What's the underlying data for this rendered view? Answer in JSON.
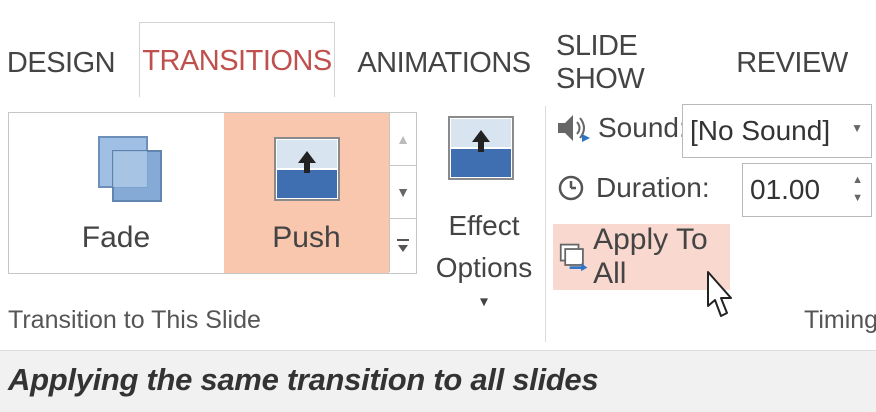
{
  "tabs": [
    {
      "label": "DESIGN",
      "active": false
    },
    {
      "label": "TRANSITIONS",
      "active": true
    },
    {
      "label": "ANIMATIONS",
      "active": false
    },
    {
      "label": "SLIDE SHOW",
      "active": false
    },
    {
      "label": "REVIEW",
      "active": false
    }
  ],
  "transition_gallery": {
    "items": [
      {
        "label": "Fade",
        "icon": "fade-icon",
        "selected": false
      },
      {
        "label": "Push",
        "icon": "push-icon",
        "selected": true
      }
    ],
    "group_label": "Transition to This Slide"
  },
  "effect_options": {
    "line1": "Effect",
    "line2": "Options",
    "dropdown_glyph": "▾"
  },
  "timing": {
    "sound_label": "Sound:",
    "sound_value": "[No Sound]",
    "duration_label": "Duration:",
    "duration_value": "01.00",
    "apply_label": "Apply To All",
    "group_label": "Timing"
  },
  "caption": "Applying the same transition to all slides",
  "colors": {
    "accent": "#c0504d",
    "selected_bg": "#f8c7ae",
    "apply_hover_bg": "#f8d8cf"
  }
}
